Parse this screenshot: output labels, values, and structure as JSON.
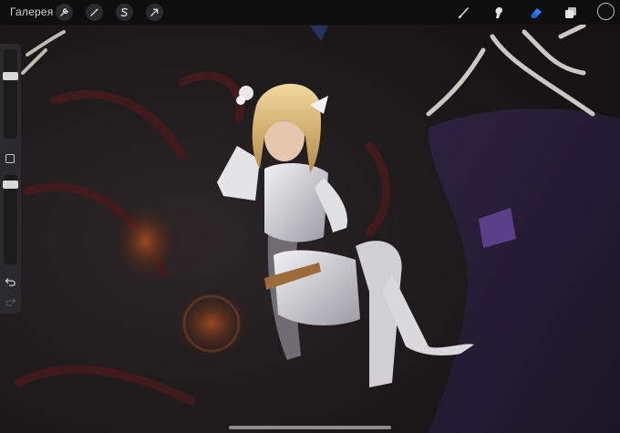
{
  "topbar": {
    "gallery_label": "Галерея",
    "left_tools": [
      {
        "icon": "wrench-icon"
      },
      {
        "icon": "magic-wand-icon"
      },
      {
        "icon": "selection-s-icon"
      },
      {
        "icon": "transform-arrow-icon"
      }
    ],
    "right_tools": [
      {
        "icon": "brush-icon"
      },
      {
        "icon": "smudge-icon"
      },
      {
        "icon": "eraser-icon",
        "active": true
      },
      {
        "icon": "layers-icon"
      }
    ],
    "current_color": "#101010",
    "active_tool_color": "#2f7bf6"
  },
  "sidebar": {
    "brush_size_level": 0.25,
    "opacity_level": 0.2,
    "icons": [
      "modify-square-icon",
      "undo-icon",
      "redo-icon"
    ]
  }
}
